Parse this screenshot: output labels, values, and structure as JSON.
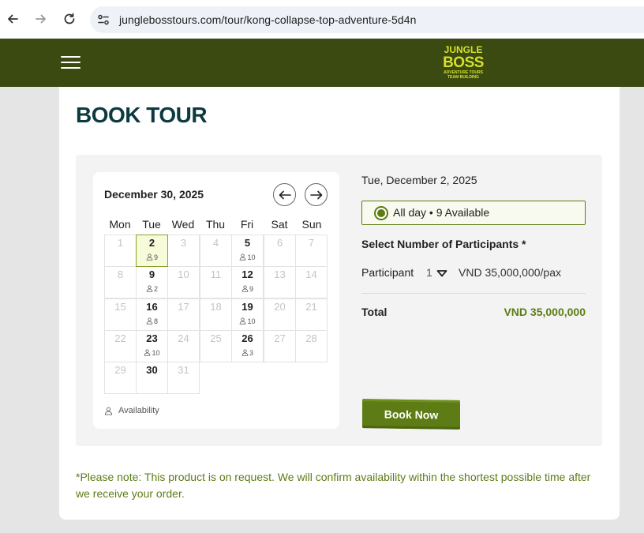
{
  "browser": {
    "url": "junglebosstours.com/tour/kong-collapse-top-adventure-5d4n"
  },
  "header": {
    "logo_lines": [
      "JUNGLE",
      "BOSS",
      "ADVENTURE TOURS",
      "TEAM BUILDING"
    ],
    "brand_color": "#3a4a10",
    "logo_color": "#d6e02a"
  },
  "page": {
    "title": "BOOK TOUR"
  },
  "calendar": {
    "month_label": "December 30, 2025",
    "weekdays": [
      "Mon",
      "Tue",
      "Wed",
      "Thu",
      "Fri",
      "Sat",
      "Sun"
    ],
    "days": [
      {
        "day": "1",
        "seats": ""
      },
      {
        "day": "2",
        "seats": "9",
        "selected": true
      },
      {
        "day": "3",
        "seats": ""
      },
      {
        "day": "4",
        "seats": ""
      },
      {
        "day": "5",
        "seats": "10"
      },
      {
        "day": "6",
        "seats": ""
      },
      {
        "day": "7",
        "seats": ""
      },
      {
        "day": "8",
        "seats": ""
      },
      {
        "day": "9",
        "seats": "2"
      },
      {
        "day": "10",
        "seats": ""
      },
      {
        "day": "11",
        "seats": ""
      },
      {
        "day": "12",
        "seats": "9"
      },
      {
        "day": "13",
        "seats": ""
      },
      {
        "day": "14",
        "seats": ""
      },
      {
        "day": "15",
        "seats": ""
      },
      {
        "day": "16",
        "seats": "8"
      },
      {
        "day": "17",
        "seats": ""
      },
      {
        "day": "18",
        "seats": ""
      },
      {
        "day": "19",
        "seats": "10"
      },
      {
        "day": "20",
        "seats": ""
      },
      {
        "day": "21",
        "seats": ""
      },
      {
        "day": "22",
        "seats": ""
      },
      {
        "day": "23",
        "seats": "10"
      },
      {
        "day": "24",
        "seats": ""
      },
      {
        "day": "25",
        "seats": ""
      },
      {
        "day": "26",
        "seats": "3"
      },
      {
        "day": "27",
        "seats": ""
      },
      {
        "day": "28",
        "seats": ""
      },
      {
        "day": "29",
        "seats": ""
      },
      {
        "day": "30",
        "seats": "",
        "bold": true
      },
      {
        "day": "31",
        "seats": ""
      }
    ],
    "legend_label": "Availability"
  },
  "booking": {
    "selected_date": "Tue, December 2, 2025",
    "slot_label": "All day • 9 Available",
    "participants_heading": "Select Number of Participants *",
    "participant_label": "Participant",
    "participant_qty": "1",
    "participant_price": "VND 35,000,000/pax",
    "total_label": "Total",
    "total_value": "VND 35,000,000",
    "book_button": "Book Now",
    "accent_color": "#5d7c15"
  },
  "note": "*Please note: This product is on request. We will confirm availability within the shortest possible time after we receive your order."
}
